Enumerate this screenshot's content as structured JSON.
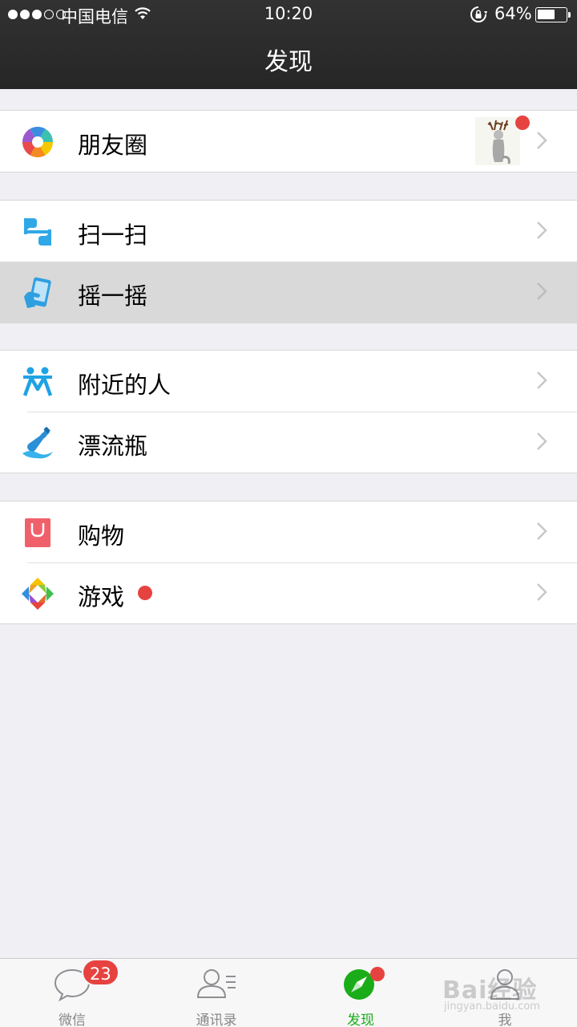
{
  "status_bar": {
    "carrier": "中国电信",
    "time": "10:20",
    "battery": "64%",
    "battery_level": 0.64
  },
  "nav": {
    "title": "发现"
  },
  "groups": [
    {
      "items": [
        {
          "label": "朋友圈",
          "icon": "moments-aperture-icon",
          "has_thumbnail": true,
          "has_badge": true
        }
      ]
    },
    {
      "items": [
        {
          "label": "扫一扫",
          "icon": "scan-icon"
        },
        {
          "label": "摇一摇",
          "icon": "shake-phone-icon",
          "pressed": true
        }
      ]
    },
    {
      "items": [
        {
          "label": "附近的人",
          "icon": "people-nearby-icon"
        },
        {
          "label": "漂流瓶",
          "icon": "drift-bottle-icon"
        }
      ]
    },
    {
      "items": [
        {
          "label": "购物",
          "icon": "shopping-bag-icon"
        },
        {
          "label": "游戏",
          "icon": "games-diamond-icon",
          "has_badge": true
        }
      ]
    }
  ],
  "tabbar": {
    "tabs": [
      {
        "label": "微信",
        "icon": "chat-bubble-icon",
        "badge": "23"
      },
      {
        "label": "通讯录",
        "icon": "contacts-icon"
      },
      {
        "label": "发现",
        "icon": "compass-icon",
        "active": true,
        "has_dot": true
      },
      {
        "label": "我",
        "icon": "me-person-icon"
      }
    ]
  },
  "watermark": {
    "line1": "Bai经验",
    "line2": "jingyan.baidu.com"
  },
  "colors": {
    "accent_green": "#1aad19",
    "badge_red": "#e64340",
    "navbar": "#2b2b2b",
    "background": "#efeff4"
  }
}
